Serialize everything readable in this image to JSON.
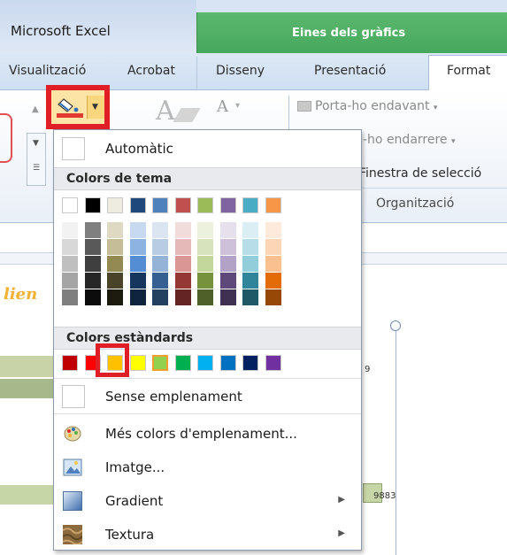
{
  "titlebar": {
    "app_title": "Microsoft Excel",
    "tools_title": "Eines dels gràfics"
  },
  "tabs": [
    {
      "label": "Visualització"
    },
    {
      "label": "Acrobat"
    },
    {
      "label": "Disseny"
    },
    {
      "label": "Presentació"
    },
    {
      "label": "Format"
    }
  ],
  "ribbon": {
    "bring_forward": "Porta-ho endavant",
    "send_backward": "-ho endarrere",
    "selection_pane": "Finestra de selecció",
    "group_label": "Organització"
  },
  "menu": {
    "automatic": "Automàtic",
    "theme_colors_header": "Colors de tema",
    "standard_colors_header": "Colors estàndards",
    "no_fill": "Sense emplenament",
    "more_colors": "Més colors d'emplenament...",
    "picture": "Imatge...",
    "gradient": "Gradient",
    "texture": "Textura",
    "theme_colors": [
      "#ffffff",
      "#000000",
      "#eeece1",
      "#1f497d",
      "#4f81bd",
      "#c0504d",
      "#9bbb59",
      "#8064a2",
      "#4bacc6",
      "#f79646"
    ],
    "theme_shades": [
      [
        "#f2f2f2",
        "#d8d8d8",
        "#bfbfbf",
        "#a5a5a5",
        "#7f7f7f"
      ],
      [
        "#7f7f7f",
        "#595959",
        "#3f3f3f",
        "#262626",
        "#0c0c0c"
      ],
      [
        "#ddd9c3",
        "#c4bd97",
        "#938953",
        "#494429",
        "#1d1b10"
      ],
      [
        "#c6d9f0",
        "#8db3e2",
        "#548dd4",
        "#17365d",
        "#0f243e"
      ],
      [
        "#dbe5f1",
        "#b8cce4",
        "#95b3d7",
        "#366092",
        "#244061"
      ],
      [
        "#f2dcdb",
        "#e5b9b7",
        "#d99694",
        "#953734",
        "#632423"
      ],
      [
        "#ebf1dd",
        "#d7e3bc",
        "#c3d69b",
        "#76923c",
        "#4f6128"
      ],
      [
        "#e5e0ec",
        "#ccc1d9",
        "#b2a2c7",
        "#5f497a",
        "#3f3151"
      ],
      [
        "#dbeef3",
        "#b7dde8",
        "#92cddc",
        "#31859b",
        "#205867"
      ],
      [
        "#fdeada",
        "#fbd5b5",
        "#fac08f",
        "#e36c09",
        "#974806"
      ]
    ],
    "standard_colors": [
      "#c00000",
      "#ff0000",
      "#ffc000",
      "#ffff00",
      "#92d050",
      "#00b050",
      "#00b0f0",
      "#0070c0",
      "#002060",
      "#7030a0"
    ],
    "selected_standard_color": "#92d050"
  },
  "slide": {
    "title_fragment": "lien",
    "value_label": "9883",
    "axis_label": "9"
  }
}
